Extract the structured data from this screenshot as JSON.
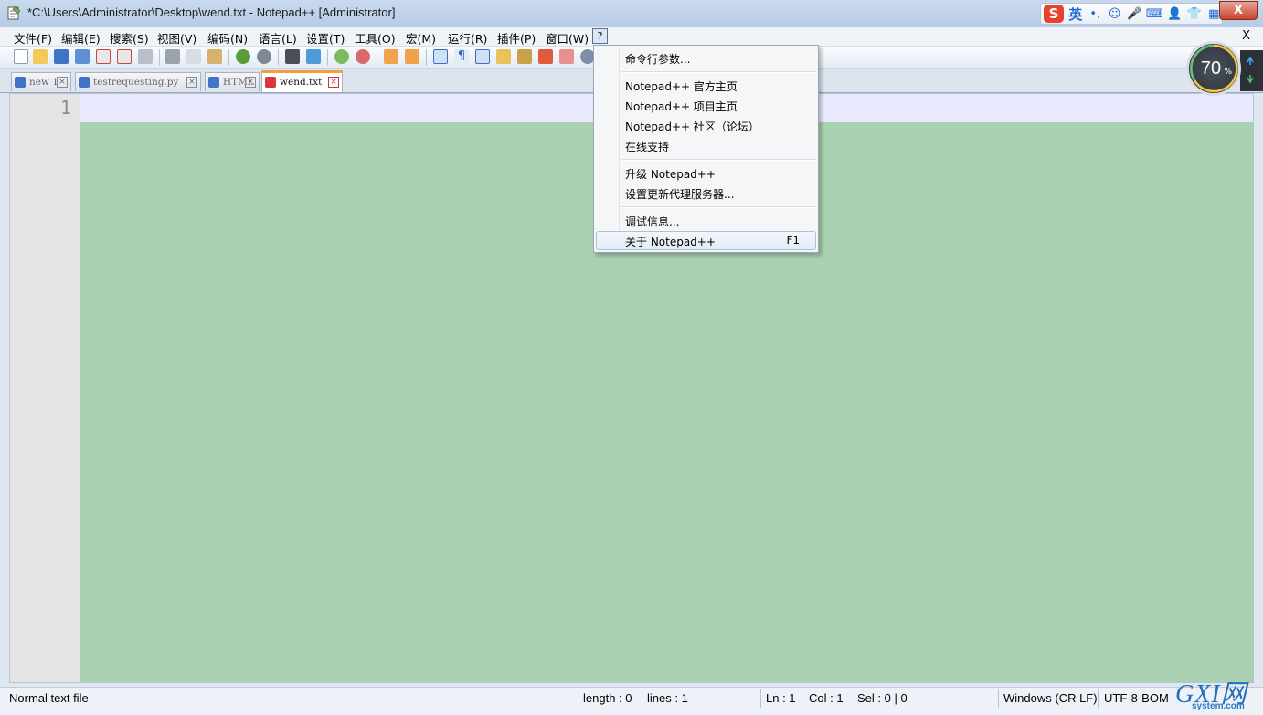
{
  "window": {
    "title": "*C:\\Users\\Administrator\\Desktop\\wend.txt - Notepad++ [Administrator]",
    "close_label": "X"
  },
  "ime": {
    "lang": "英",
    "logo": "S",
    "punct": "•,",
    "emoji": "☺",
    "mic": "🎤",
    "keyboard": "⌨",
    "user": "👤",
    "shirt": "👕",
    "grid": "▦"
  },
  "menubar": {
    "items": [
      "文件(F)",
      "编辑(E)",
      "搜索(S)",
      "视图(V)",
      "编码(N)",
      "语言(L)",
      "设置(T)",
      "工具(O)",
      "宏(M)",
      "运行(R)",
      "插件(P)",
      "窗口(W)"
    ],
    "help": "?",
    "close": "X"
  },
  "tabs": [
    {
      "label": "new 1",
      "active": false
    },
    {
      "label": "testrequesting.py",
      "active": false
    },
    {
      "label": "HTML",
      "active": false
    },
    {
      "label": "wend.txt",
      "active": true
    }
  ],
  "editor": {
    "line_number": "1"
  },
  "help_menu": {
    "items": [
      {
        "label": "命令行参数..."
      },
      {
        "label": "Notepad++ 官方主页"
      },
      {
        "label": "Notepad++ 项目主页"
      },
      {
        "label": "Notepad++ 社区（论坛）"
      },
      {
        "label": "在线支持"
      },
      {
        "label": "升级 Notepad++"
      },
      {
        "label": "设置更新代理服务器..."
      },
      {
        "label": "调试信息..."
      },
      {
        "label": "关于 Notepad++",
        "shortcut": "F1",
        "highlighted": true
      }
    ]
  },
  "statusbar": {
    "file_type": "Normal text file",
    "length": "length : 0",
    "lines": "lines : 1",
    "ln": "Ln : 1",
    "col": "Col : 1",
    "sel": "Sel : 0 | 0",
    "eol": "Windows (CR LF)",
    "encoding": "UTF-8-BOM"
  },
  "overlay": {
    "gauge_value": "70",
    "gauge_unit": "%",
    "watermark_top": "GXI网",
    "watermark_bottom": "system.com"
  },
  "colors": {
    "editor_bg": "#aad1b1",
    "current_line": "#e8e8ff",
    "active_tab_accent": "#f29f3e"
  }
}
